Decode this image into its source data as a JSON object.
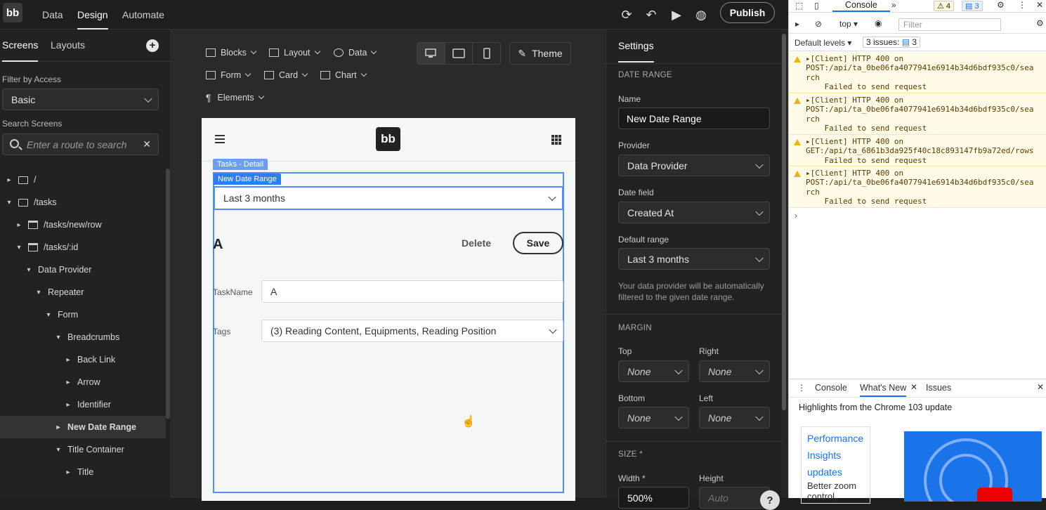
{
  "topbar": {
    "logo": "bb",
    "nav": [
      "Data",
      "Design",
      "Automate"
    ],
    "active_nav": "Design",
    "publish_label": "Publish"
  },
  "left": {
    "tabs": [
      "Screens",
      "Layouts"
    ],
    "filter_label": "Filter by Access",
    "filter_value": "Basic",
    "search_label": "Search Screens",
    "search_placeholder": "Enter a route to search",
    "tree": [
      {
        "label": "/",
        "type": "folder",
        "expanded": false
      },
      {
        "label": "/tasks",
        "type": "folder",
        "expanded": true
      },
      {
        "label": "/tasks/new/row",
        "type": "screen",
        "expanded": false
      },
      {
        "label": "/tasks/:id",
        "type": "screen",
        "expanded": true
      },
      {
        "label": "Data Provider",
        "type": "component",
        "expanded": true
      },
      {
        "label": "Repeater",
        "type": "component",
        "expanded": true
      },
      {
        "label": "Form",
        "type": "component",
        "expanded": true
      },
      {
        "label": "Breadcrumbs",
        "type": "component",
        "expanded": true
      },
      {
        "label": "Back Link",
        "type": "component",
        "expanded": false
      },
      {
        "label": "Arrow",
        "type": "component",
        "expanded": false
      },
      {
        "label": "Identifier",
        "type": "component",
        "expanded": false
      },
      {
        "label": "New Date Range",
        "type": "component",
        "expanded": false,
        "selected": true
      },
      {
        "label": "Title Container",
        "type": "component",
        "expanded": true
      },
      {
        "label": "Title",
        "type": "component",
        "expanded": false
      }
    ]
  },
  "toolbar": {
    "row1": [
      "Blocks",
      "Layout",
      "Data"
    ],
    "row2": [
      "Form",
      "Card",
      "Chart"
    ],
    "row3": [
      "Elements"
    ],
    "theme_label": "Theme"
  },
  "canvas": {
    "logo": "bb",
    "tag_outer": "Tasks - Detail",
    "tag_inner": "New Date Range",
    "daterange_value": "Last 3 months",
    "title": "A",
    "delete_label": "Delete",
    "save_label": "Save",
    "fields": [
      {
        "label": "TaskName",
        "value": "A"
      },
      {
        "label": "Tags",
        "value": "(3) Reading Content, Equipments, Reading Position"
      }
    ]
  },
  "settings": {
    "title": "Settings",
    "section1": "DATE RANGE",
    "name_label": "Name",
    "name_value": "New Date Range",
    "provider_label": "Provider",
    "provider_value": "Data Provider",
    "datefield_label": "Date field",
    "datefield_value": "Created At",
    "default_label": "Default range",
    "default_value": "Last 3 months",
    "note": "Your data provider will be automatically filtered to the given date range.",
    "section2": "MARGIN",
    "top_label": "Top",
    "right_label": "Right",
    "bottom_label": "Bottom",
    "left_label": "Left",
    "margin_value": "None",
    "section3": "SIZE *",
    "width_label": "Width *",
    "height_label": "Height",
    "width_value": "500%",
    "height_placeholder": "Auto",
    "help": "?"
  },
  "devtools": {
    "tab": "Console",
    "warn_count": "4",
    "msg_count": "3",
    "context": "top",
    "filter_placeholder": "Filter",
    "levels": "Default levels",
    "issues": "3 issues:",
    "issues_count": "3",
    "logs": [
      "▸[Client] HTTP 400 on\nPOST:/api/ta_0be06fa4077941e6914b34d6bdf935c0/sea\nrch\n    Failed to send request",
      "▸[Client] HTTP 400 on\nPOST:/api/ta_0be06fa4077941e6914b34d6bdf935c0/sea\nrch\n    Failed to send request",
      "▸[Client] HTTP 400 on\nGET:/api/ta_6861b3da925f40c18c893147fb9a72ed/rows\n    Failed to send request",
      "▸[Client] HTTP 400 on\nPOST:/api/ta_0be06fa4077941e6914b34d6bdf935c0/sea\nrch\n    Failed to send request"
    ],
    "drawer_tabs": [
      "Console",
      "What's New",
      "Issues"
    ],
    "whatsnew_title": "Highlights from the Chrome 103 update",
    "card_title": "Performance Insights updates",
    "card_text": "Better zoom control,"
  }
}
